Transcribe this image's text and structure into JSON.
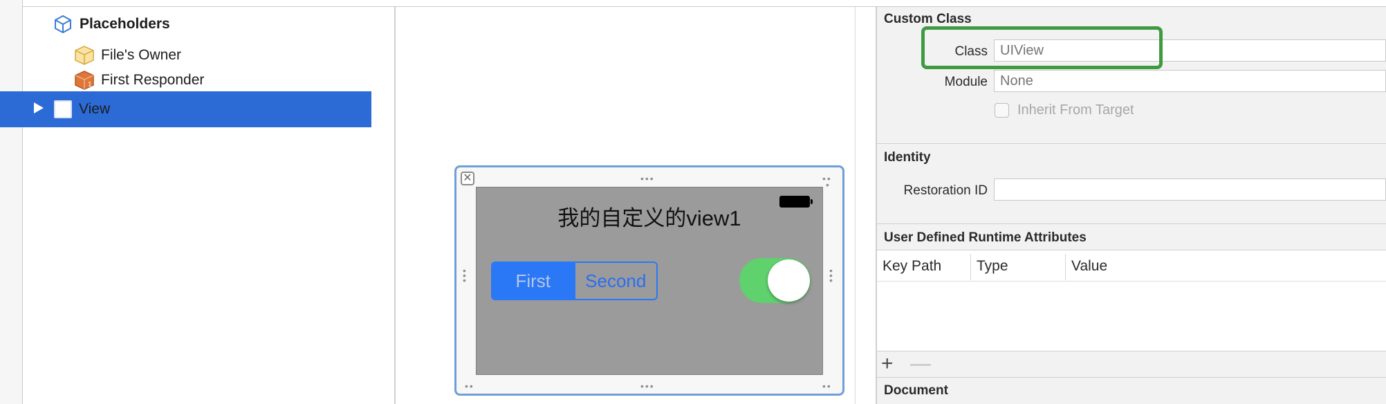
{
  "outline": {
    "placeholders": "Placeholders",
    "files_owner": "File's Owner",
    "first_responder": "First Responder",
    "view": "View"
  },
  "canvas": {
    "title": "我的自定义的view1",
    "segments": [
      "First",
      "Second"
    ],
    "selected_segment": "First",
    "switch_on": true,
    "close_icon": "close-icon"
  },
  "inspector": {
    "custom_class": {
      "title": "Custom Class",
      "class_label": "Class",
      "class_placeholder": "UIView",
      "module_label": "Module",
      "module_placeholder": "None",
      "inherit_label": "Inherit From Target"
    },
    "identity": {
      "title": "Identity",
      "restoration_label": "Restoration ID",
      "restoration_value": ""
    },
    "runtime_attributes": {
      "title": "User Defined Runtime Attributes",
      "columns": [
        "Key Path",
        "Type",
        "Value"
      ],
      "add": "+",
      "remove": "—"
    },
    "document": {
      "title": "Document"
    }
  },
  "colors": {
    "selection": "#2c6bd6",
    "highlight_box": "#3f9a41",
    "segment_tint": "#2a78f5",
    "switch_on": "#5fd16d"
  }
}
